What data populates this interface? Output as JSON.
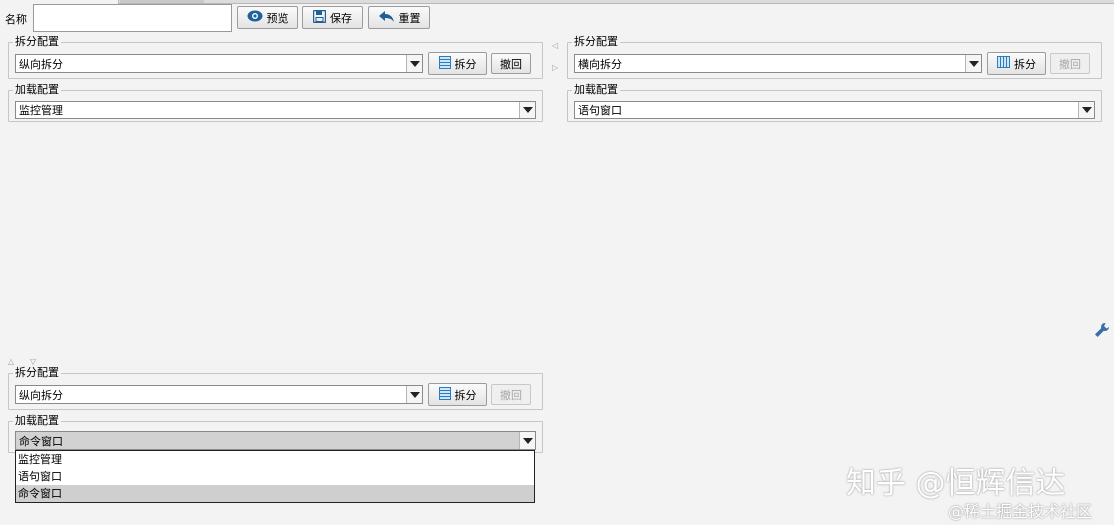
{
  "toolbar": {
    "name_label": "名称",
    "name_value": "",
    "preview_label": "预览",
    "save_label": "保存",
    "reset_label": "重置"
  },
  "panels": [
    {
      "split_title": "拆分配置",
      "split_value": "纵向拆分",
      "split_button": "拆分",
      "undo_button": "撤回",
      "load_title": "加载配置",
      "load_value": "监控管理"
    },
    {
      "split_title": "拆分配置",
      "split_value": "横向拆分",
      "split_button": "拆分",
      "undo_button": "撤回",
      "load_title": "加载配置",
      "load_value": "语句窗口"
    },
    {
      "split_title": "拆分配置",
      "split_value": "纵向拆分",
      "split_button": "拆分",
      "undo_button": "撤回",
      "load_title": "加载配置",
      "load_value": "命令窗口",
      "load_options": [
        "监控管理",
        "语句窗口",
        "命令窗口"
      ]
    }
  ],
  "watermark": {
    "main": "知乎 @恒辉信达",
    "sub": "@稀土掘金技术社区"
  },
  "icons": {
    "preview": "eye-icon",
    "save": "floppy-icon",
    "reset": "undo-arrow-icon",
    "split_vertical": "rows-icon",
    "split_horizontal": "columns-icon",
    "settings": "wrench-icon"
  }
}
